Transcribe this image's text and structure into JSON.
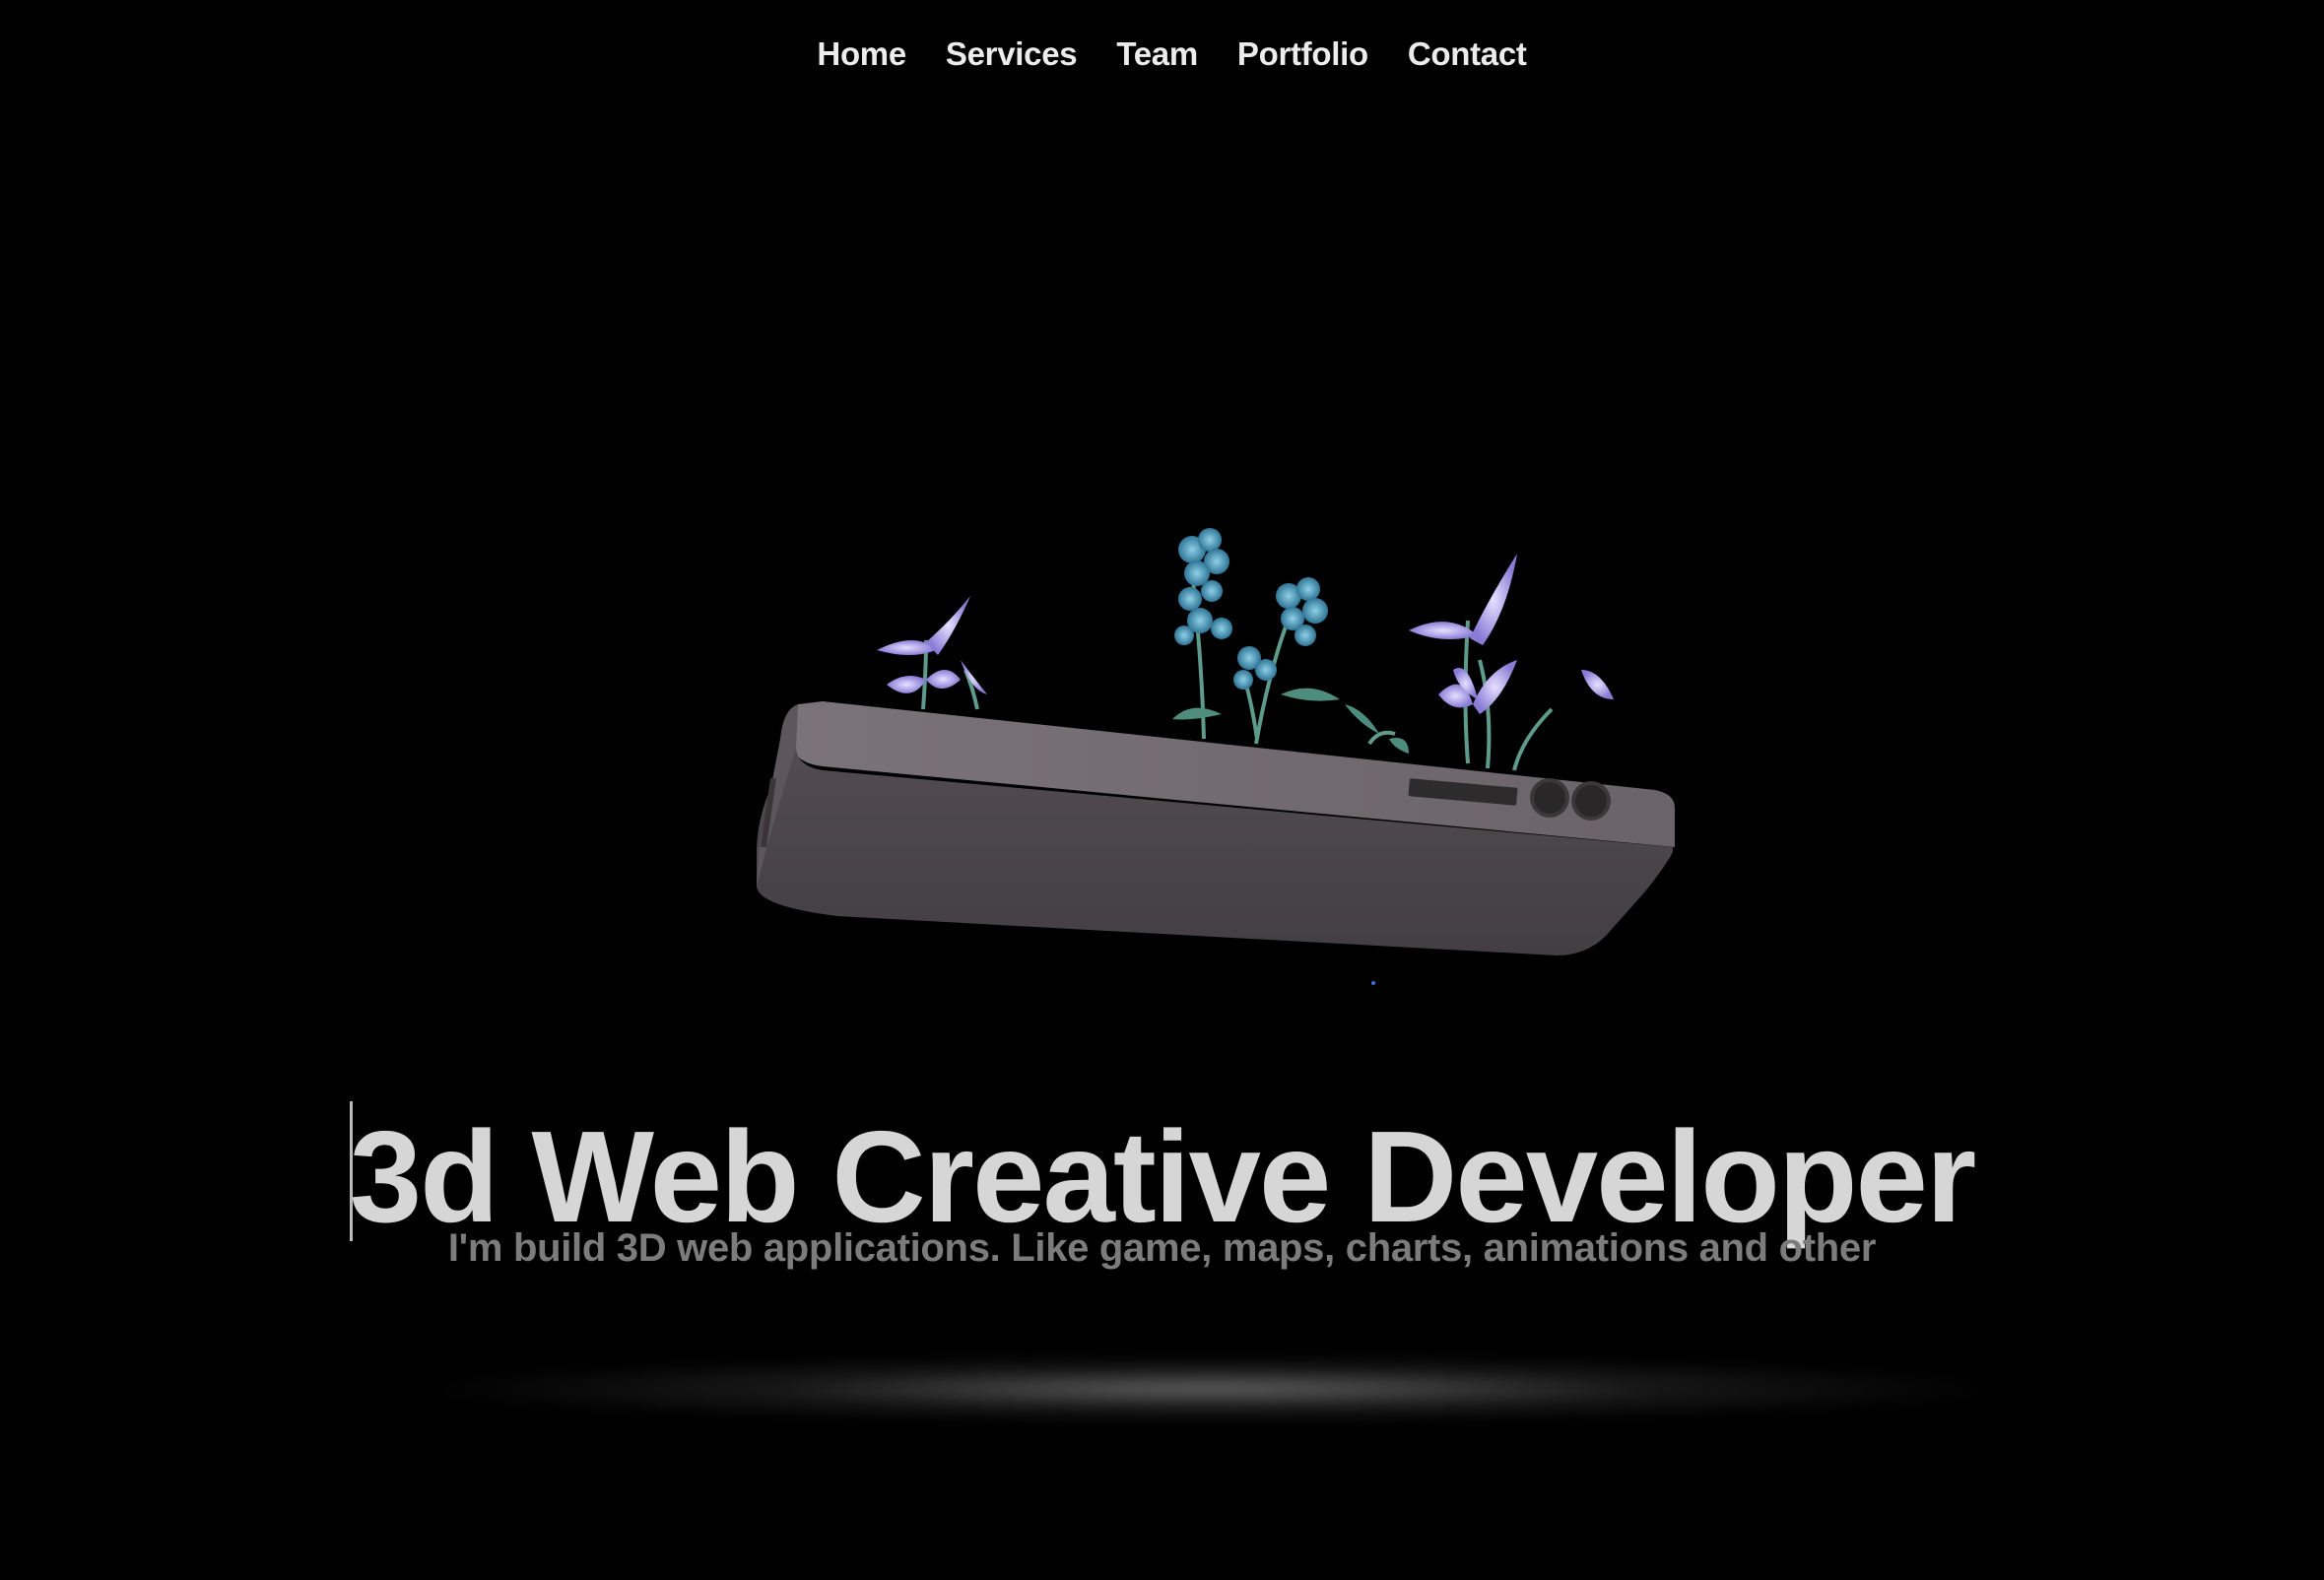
{
  "nav": {
    "items": [
      {
        "label": "Home"
      },
      {
        "label": "Services"
      },
      {
        "label": "Team"
      },
      {
        "label": "Portfolio"
      },
      {
        "label": "Contact"
      }
    ]
  },
  "hero": {
    "illustration": "phone-with-flowers-3d",
    "title": "3d Web Creative Developer",
    "subtitle": "I'm build 3D web applications. Like game, maps, charts, animations and other"
  },
  "colors": {
    "background": "#000000",
    "title": "#d6d6d6",
    "subtitle": "#7c7c7c",
    "nav": "#ececec",
    "phone_body": "#4a4548",
    "phone_top": "#6e676c",
    "flower_blue": "#3f8fae",
    "flower_purple": "#9d8ee0"
  }
}
